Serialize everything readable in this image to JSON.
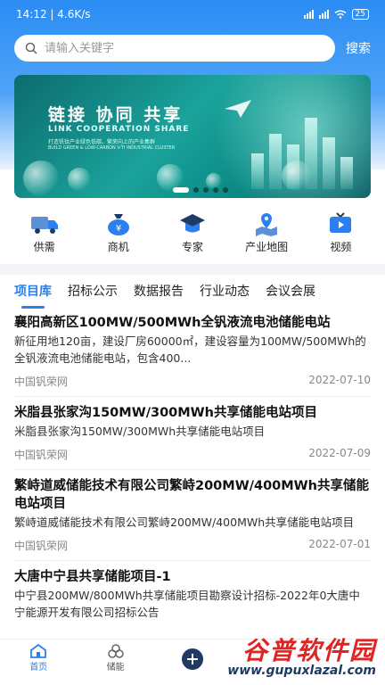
{
  "status_bar": {
    "time": "14:12",
    "speed": "4.6K/s",
    "battery": "25"
  },
  "search": {
    "placeholder": "请输入关键字",
    "button_label": "搜索"
  },
  "banner": {
    "title": "链接  协同  共享",
    "subtitle_en": "LINK COOPERATION SHARE",
    "slogan_cn": "打造钒钛产业绿色低碳、繁荣向上的产业集群",
    "slogan_en": "BUILD GREEN & LOW-CARBON V-TI INDUSTRIAL CLUSTER",
    "dots_count": 5,
    "active_dot": 0
  },
  "quick_nav": [
    {
      "label": "供需",
      "icon": "truck-icon"
    },
    {
      "label": "商机",
      "icon": "money-bag-icon"
    },
    {
      "label": "专家",
      "icon": "graduation-cap-icon"
    },
    {
      "label": "产业地图",
      "icon": "map-pin-icon"
    },
    {
      "label": "视频",
      "icon": "tv-icon"
    }
  ],
  "tabs": [
    {
      "label": "项目库",
      "active": true
    },
    {
      "label": "招标公示",
      "active": false
    },
    {
      "label": "数据报告",
      "active": false
    },
    {
      "label": "行业动态",
      "active": false
    },
    {
      "label": "会议会展",
      "active": false
    }
  ],
  "articles": [
    {
      "title": "襄阳高新区100MW/500MWh全钒液流电池储能电站",
      "summary": "新征用地120亩，建设厂房60000㎡，建设容量为100MW/500MWh的全钒液流电池储能电站，包含400...",
      "source": "中国钒荣网",
      "date": "2022-07-10"
    },
    {
      "title": "米脂县张家沟150MW/300MWh共享储能电站项目",
      "summary": "米脂县张家沟150MW/300MWh共享储能电站项目",
      "source": "中国钒荣网",
      "date": "2022-07-09"
    },
    {
      "title": "繁峙道威储能技术有限公司繁峙200MW/400MWh共享储能电站项目",
      "summary": "繁峙道威储能技术有限公司繁峙200MW/400MWh共享储能电站项目",
      "source": "中国钒荣网",
      "date": "2022-07-01"
    },
    {
      "title": "大唐中宁县共享储能项目-1",
      "summary": "中宁县200MW/800MWh共享储能项目勘察设计招标-2022年0大唐中宁能源开发有限公司招标公告",
      "source": "",
      "date": ""
    }
  ],
  "tabbar": [
    {
      "label": "首页",
      "icon": "home-icon",
      "active": true
    },
    {
      "label": "储能",
      "icon": "storage-icon",
      "active": false
    },
    {
      "label": "",
      "icon": "plus-icon",
      "active": false
    }
  ],
  "watermark": {
    "title": "谷普软件园",
    "url": "www.gupuxlazal.com"
  },
  "colors": {
    "accent": "#2b7ff0",
    "header": "#2b8cf3"
  }
}
